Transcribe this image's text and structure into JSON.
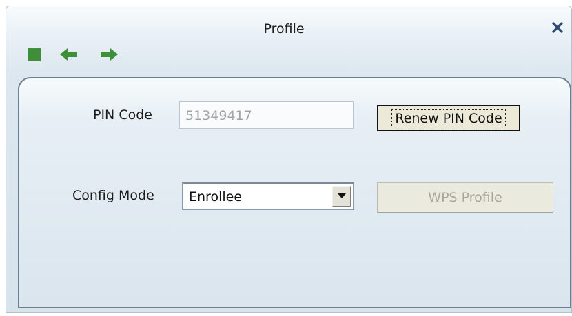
{
  "window": {
    "title": "Profile"
  },
  "toolbar": {
    "icons": [
      "stop-icon",
      "back-arrow-icon",
      "forward-arrow-icon"
    ],
    "icon_color": "#3f8f3a"
  },
  "form": {
    "pin_code_label": "PIN Code",
    "pin_code_value": "51349417",
    "renew_button_label": "Renew PIN Code",
    "config_mode_label": "Config Mode",
    "config_mode_value": "Enrollee",
    "wps_profile_button_label": "WPS Profile"
  },
  "colors": {
    "accent_green": "#3f8f3a",
    "close_icon": "#2d4a73",
    "disabled_text": "#a9a699"
  }
}
